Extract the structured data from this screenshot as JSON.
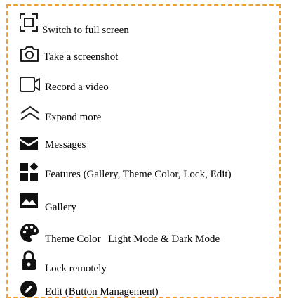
{
  "accent_color": "#f0a030",
  "items": [
    {
      "icon": "fullscreen-icon",
      "label": "Switch to full screen"
    },
    {
      "icon": "camera-icon",
      "label": "Take a screenshot"
    },
    {
      "icon": "video-camera-icon",
      "label": "Record a video"
    },
    {
      "icon": "chevron-up-icon",
      "label": "Expand more"
    },
    {
      "icon": "mail-icon",
      "label": "Messages"
    },
    {
      "icon": "widgets-icon",
      "label": "Features (Gallery, Theme Color, Lock, Edit)"
    },
    {
      "icon": "image-icon",
      "label": "Gallery"
    },
    {
      "icon": "palette-icon",
      "label": "Theme Color",
      "extra": "Light Mode & Dark Mode"
    },
    {
      "icon": "lock-icon",
      "label": "Lock remotely"
    },
    {
      "icon": "edit-icon",
      "label": "Edit (Button Management)"
    }
  ]
}
